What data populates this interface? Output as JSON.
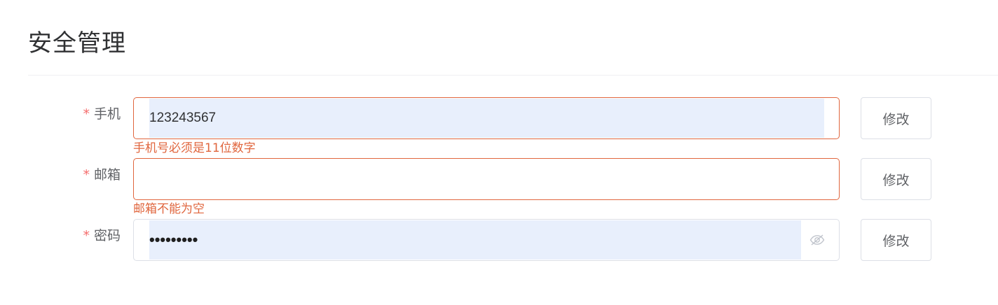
{
  "page": {
    "title": "安全管理"
  },
  "form": {
    "phone": {
      "required_mark": "*",
      "label": "手机",
      "value": "123243567",
      "error": "手机号必须是11位数字",
      "button": "修改"
    },
    "email": {
      "required_mark": "*",
      "label": "邮箱",
      "value": "",
      "error": "邮箱不能为空",
      "button": "修改"
    },
    "password": {
      "required_mark": "*",
      "label": "密码",
      "value": "•••••••••",
      "toggle_icon": "eye-slash-icon",
      "button": "修改"
    }
  },
  "colors": {
    "error": "#e0663e",
    "autofill_bg": "#e8effc",
    "label": "#606266",
    "title": "#303133"
  }
}
